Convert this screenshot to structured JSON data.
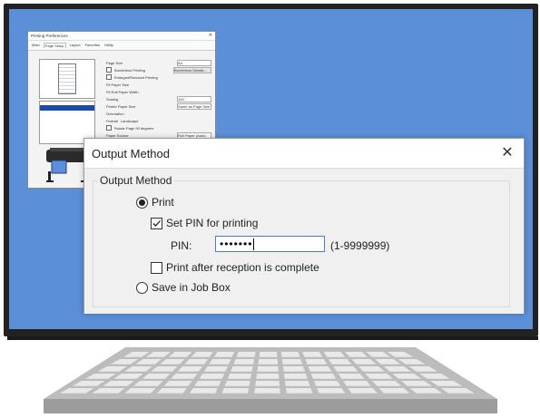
{
  "background_window": {
    "title": "Printing Preferences",
    "tabs": [
      "Main",
      "Page Setup",
      "Layout",
      "Favorites",
      "Utility"
    ],
    "active_tab": "Page Setup",
    "rows": [
      {
        "label": "Page Size",
        "value": "A4"
      },
      {
        "label": "Borderless Printing",
        "button": "Borderless Details..."
      },
      {
        "label": "Enlarged/Reduced Printing"
      },
      {
        "label": "Fit Paper Size"
      },
      {
        "label": "Fit Roll Paper Width"
      },
      {
        "label": "Scaling",
        "value": "100"
      },
      {
        "label": "Printer Paper Size",
        "value": "Same as Page Size"
      },
      {
        "label": "Orientation"
      },
      {
        "label": "Portrait"
      },
      {
        "label": "Landscape"
      },
      {
        "label": "Rotate Page 90 degrees"
      },
      {
        "label": "Paper Source",
        "value": "Roll Paper (Auto)"
      }
    ]
  },
  "dialog": {
    "title": "Output Method",
    "close_glyph": "✕",
    "group_label": "Output Method",
    "print_label": "Print",
    "set_pin_label": "Set PIN for printing",
    "pin_label": "PIN:",
    "pin_value": "•••••••",
    "pin_range": "(1-9999999)",
    "print_after_label": "Print after reception is complete",
    "save_job_box_label": "Save in Job Box",
    "print_selected": true,
    "set_pin_checked": true,
    "print_after_checked": false,
    "save_job_box_selected": false
  },
  "colors": {
    "screen": "#5b8fd8",
    "bezel": "#222222",
    "dialog_body": "#f0f0f0",
    "input_border": "#4a7bc8"
  },
  "icons": {
    "close": "close-icon",
    "printer": "printer-icon",
    "keyboard": "keyboard-illustration"
  }
}
